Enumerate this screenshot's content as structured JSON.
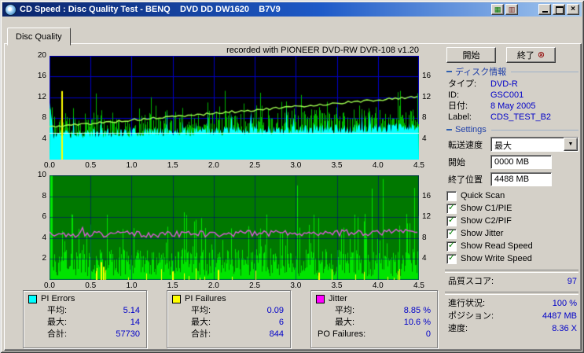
{
  "window": {
    "title": "CD Speed : Disc Quality Test - BENQ    DVD DD DW1620    B7V9"
  },
  "icons": {
    "copy": "▦",
    "save": "▥",
    "close": "×",
    "exit": "⊗",
    "dropdown": "▼",
    "check": "✓"
  },
  "tab": {
    "label": "Disc Quality"
  },
  "chart_area": {
    "recorded_note": "recorded with PIONEER DVD-RW  DVR-108  v1.20"
  },
  "actions": {
    "start": "開始",
    "exit": "終了"
  },
  "disc_info": {
    "header": "ディスク情報",
    "rows": [
      {
        "label": "タイプ:",
        "value": "DVD-R"
      },
      {
        "label": "ID:",
        "value": "GSC001"
      },
      {
        "label": "日付:",
        "value": "8 May 2005"
      },
      {
        "label": "Label:",
        "value": "CDS_TEST_B2"
      }
    ]
  },
  "settings": {
    "header": "Settings",
    "transfer": {
      "label": "転送速度",
      "value": "最大"
    },
    "start_field": {
      "label": "開始",
      "value": "0000 MB"
    },
    "end_field": {
      "label": "終了位置",
      "value": "4488 MB"
    },
    "checkboxes": [
      {
        "label": "Quick Scan",
        "checked": false
      },
      {
        "label": "Show C1/PIE",
        "checked": true
      },
      {
        "label": "Show C2/PIF",
        "checked": true
      },
      {
        "label": "Show Jitter",
        "checked": true
      },
      {
        "label": "Show Read Speed",
        "checked": true
      },
      {
        "label": "Show Write Speed",
        "checked": true
      }
    ]
  },
  "status": {
    "score_label": "品質スコア:",
    "score_value": "97",
    "progress_label": "進行状況:",
    "progress_value": "100 %",
    "position_label": "ポジション:",
    "position_value": "4487 MB",
    "speed_label": "速度:",
    "speed_value": "8.36 X"
  },
  "legend_boxes": [
    {
      "title": "PI Errors",
      "swatch": "#00FFFF",
      "rows": [
        {
          "label": "平均:",
          "value": "5.14"
        },
        {
          "label": "最大:",
          "value": "14"
        },
        {
          "label": "合計:",
          "value": "57730"
        }
      ]
    },
    {
      "title": "PI Failures",
      "swatch": "#FFFF00",
      "rows": [
        {
          "label": "平均:",
          "value": "0.09"
        },
        {
          "label": "最大:",
          "value": "6"
        },
        {
          "label": "合計:",
          "value": "844"
        }
      ]
    },
    {
      "title": "Jitter",
      "swatch": "#FF00FF",
      "rows": [
        {
          "label": "平均:",
          "value": "8.85 %"
        },
        {
          "label": "最大:",
          "value": "10.6 %"
        },
        {
          "label": "PO Failures:",
          "value": "0"
        }
      ]
    }
  ],
  "chart_data": [
    {
      "type": "area",
      "name": "pi-errors-and-read-speed",
      "x_range": [
        0,
        4.5
      ],
      "y_range": [
        0,
        20
      ],
      "x_ticks": [
        "0.0",
        "0.5",
        "1.0",
        "1.5",
        "2.0",
        "2.5",
        "3.0",
        "3.5",
        "4.0",
        "4.5"
      ],
      "y_left_ticks": [
        20,
        16,
        12,
        8,
        4
      ],
      "y_right": {
        "labels": [
          "16",
          "12",
          "8",
          "4"
        ],
        "rows": [
          16,
          12,
          8,
          4
        ]
      },
      "bg": "#000000",
      "grid_color": "#0000C8",
      "series": [
        {
          "name": "PI Errors",
          "type": "area",
          "color": "#00FFFF",
          "avg": 5.14,
          "max": 14,
          "total": 57730,
          "gen": {
            "seed": 11,
            "base": 4.0,
            "noise": 1.9,
            "trend": 1.3,
            "spike_p": 0.05,
            "spike_h": 5,
            "left_burst": 11
          }
        },
        {
          "name": "Error spikes",
          "type": "spikes",
          "color": "#00B400",
          "gen": {
            "seed": 23,
            "over": 5,
            "tall_p": 0.035,
            "tall_base": 9,
            "tall_h": 4.5
          }
        },
        {
          "name": "Read Speed",
          "type": "line",
          "color": "#A0FF50",
          "start": 6.3,
          "end": 12.15,
          "gen": {
            "seed": 5,
            "noise": 0.22
          }
        },
        {
          "name": "Average line",
          "type": "hline",
          "color": "#D8FFF8",
          "y": 5.2
        },
        {
          "name": "Start marker",
          "type": "vline",
          "color": "#FFFF00",
          "x": 0.15,
          "height": 13.2
        }
      ]
    },
    {
      "type": "area",
      "name": "pi-failures-and-jitter",
      "x_range": [
        0,
        4.5
      ],
      "y_range": [
        0,
        10
      ],
      "x_ticks": [
        "0.0",
        "0.5",
        "1.0",
        "1.5",
        "2.0",
        "2.5",
        "3.0",
        "3.5",
        "4.0",
        "4.5"
      ],
      "y_left_ticks": [
        10,
        8,
        6,
        4,
        2
      ],
      "y_right": {
        "labels": [
          "16",
          "12",
          "8",
          "4"
        ],
        "rows": [
          8,
          6,
          4,
          2
        ]
      },
      "bg": "#007800",
      "grid_color": "rgba(0,0,130,0.55)",
      "po_failures": 0,
      "series": [
        {
          "name": "Write Speed field",
          "type": "spikes",
          "color": "#00E400",
          "gen": {
            "seed": 41,
            "base": 0.35,
            "spread": 2.6,
            "mid_p": 0.12,
            "tall_p": 0.02
          }
        },
        {
          "name": "PI Failures",
          "type": "spikes",
          "color": "#FFFF00",
          "avg": 0.09,
          "max": 6,
          "total": 844,
          "gen": {
            "seed": 53,
            "p": 0.05,
            "h": 1.1,
            "marks": [
              [
                0.63,
                1.7
              ],
              [
                0.66,
                1.25
              ],
              [
                1.5,
                0.8
              ],
              [
                2.06,
                0.95
              ],
              [
                3.28,
                0.7
              ]
            ]
          }
        },
        {
          "name": "Jitter",
          "type": "line",
          "color": "#DA5ADA",
          "avg": "8.85 %",
          "max": "10.6 %",
          "gen": {
            "seed": 67,
            "base": 4.3,
            "trend": 0.25,
            "noise": 0.3
          }
        }
      ]
    }
  ]
}
